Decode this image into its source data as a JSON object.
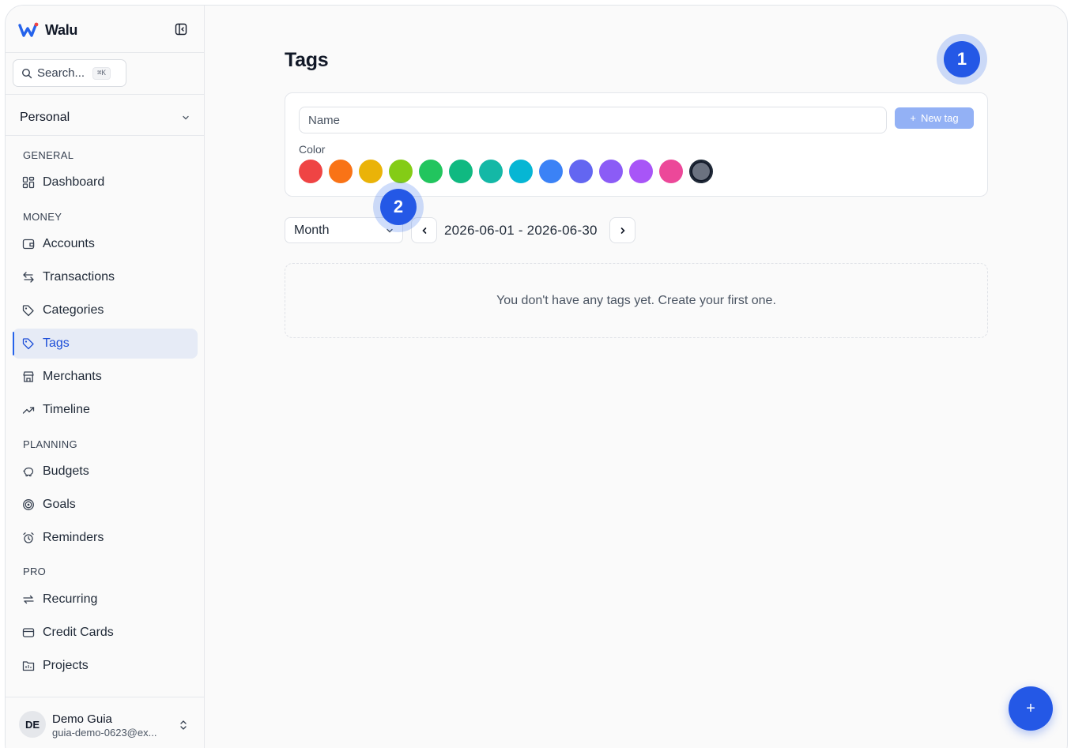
{
  "app": {
    "name": "Walu"
  },
  "search": {
    "label": "Search...",
    "shortcut": "⌘K"
  },
  "workspace": {
    "label": "Personal"
  },
  "sidebar": {
    "sections": {
      "general": "GENERAL",
      "money": "MONEY",
      "planning": "PLANNING",
      "pro": "PRO"
    },
    "items": [
      {
        "label": "Dashboard",
        "icon": "dashboard-icon"
      },
      {
        "label": "Accounts",
        "icon": "wallet-icon"
      },
      {
        "label": "Transactions",
        "icon": "arrows-exchange-icon"
      },
      {
        "label": "Categories",
        "icon": "tag-icon"
      },
      {
        "label": "Tags",
        "icon": "tag-icon",
        "active": true
      },
      {
        "label": "Merchants",
        "icon": "store-icon"
      },
      {
        "label": "Timeline",
        "icon": "trending-icon"
      },
      {
        "label": "Budgets",
        "icon": "piggy-bank-icon"
      },
      {
        "label": "Goals",
        "icon": "target-icon"
      },
      {
        "label": "Reminders",
        "icon": "alarm-icon"
      },
      {
        "label": "Recurring",
        "icon": "repeat-icon"
      },
      {
        "label": "Credit Cards",
        "icon": "credit-card-icon"
      },
      {
        "label": "Projects",
        "icon": "folder-icon"
      }
    ]
  },
  "user": {
    "initials": "DE",
    "name": "Demo Guia",
    "email": "guia-demo-0623@ex..."
  },
  "page": {
    "title": "Tags",
    "name_placeholder": "Name",
    "new_tag_label": "New tag",
    "color_label": "Color",
    "colors": [
      "#ef4444",
      "#f97316",
      "#eab308",
      "#84cc16",
      "#22c55e",
      "#10b981",
      "#14b8a6",
      "#06b6d4",
      "#3b82f6",
      "#6366f1",
      "#8b5cf6",
      "#a855f7",
      "#ec4899",
      "#6b7280"
    ],
    "selected_color": "#6b7280",
    "period": "Month",
    "date_range": "2026-06-01 - 2026-06-30",
    "empty_message": "You don't have any tags yet. Create your first one."
  },
  "markers": {
    "one": "1",
    "two": "2"
  },
  "fab": {
    "label": "+"
  },
  "colors": {
    "accent": "#2458e6",
    "active_bg": "#e6ebf6"
  }
}
